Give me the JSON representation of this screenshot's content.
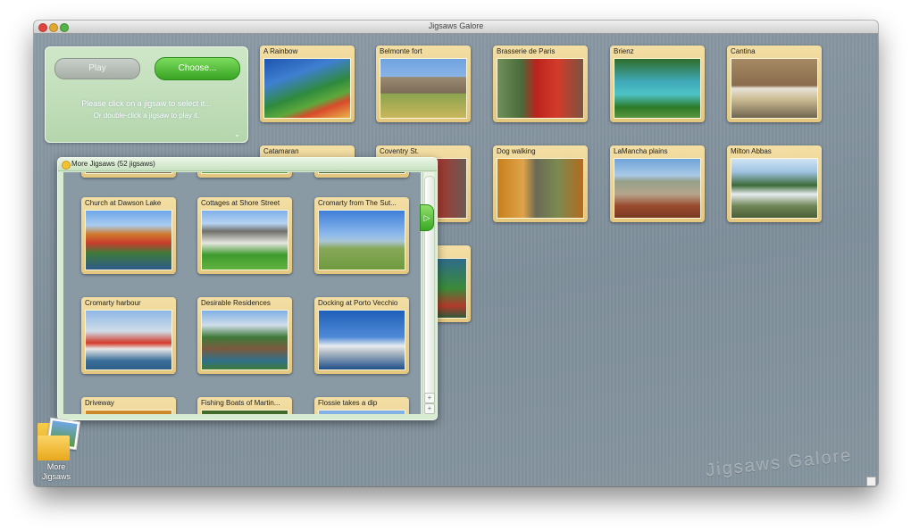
{
  "window": {
    "title": "Jigsaws Galore"
  },
  "panel": {
    "play_label": "Play",
    "choose_label": "Choose...",
    "message_line1": "Please click on a jigsaw to select it...",
    "message_line2": "Or double-click a jigsaw to play it.",
    "chevron": "⌄"
  },
  "jigsaws": [
    {
      "label": "A Rainbow"
    },
    {
      "label": "Belmonte fort"
    },
    {
      "label": "Brasserie de Paris"
    },
    {
      "label": "Brienz"
    },
    {
      "label": "Cantina"
    },
    {
      "label": "Catamaran"
    },
    {
      "label": "Coventry St."
    },
    {
      "label": "Dog walking"
    },
    {
      "label": "LaMancha plains"
    },
    {
      "label": "Milton Abbas"
    }
  ],
  "more_panel": {
    "title": "More Jigsaws  (52 jigsaws)",
    "tab_glyph": "▷",
    "scroll_up": "+",
    "scroll_down": "+",
    "items": [
      {
        "label": "Church at Dawson Lake"
      },
      {
        "label": "Cottages at Shore Street"
      },
      {
        "label": "Cromarty from The Sut..."
      },
      {
        "label": "Cromarty harbour"
      },
      {
        "label": "Desirable Residences"
      },
      {
        "label": "Docking at Porto Vecchio"
      },
      {
        "label": "Driveway"
      },
      {
        "label": "Fishing Boats of Martin..."
      },
      {
        "label": "Flossie takes a dip"
      }
    ]
  },
  "desktop_icon": {
    "label": "More Jigsaws"
  },
  "watermark": "Jigsaws Galore"
}
